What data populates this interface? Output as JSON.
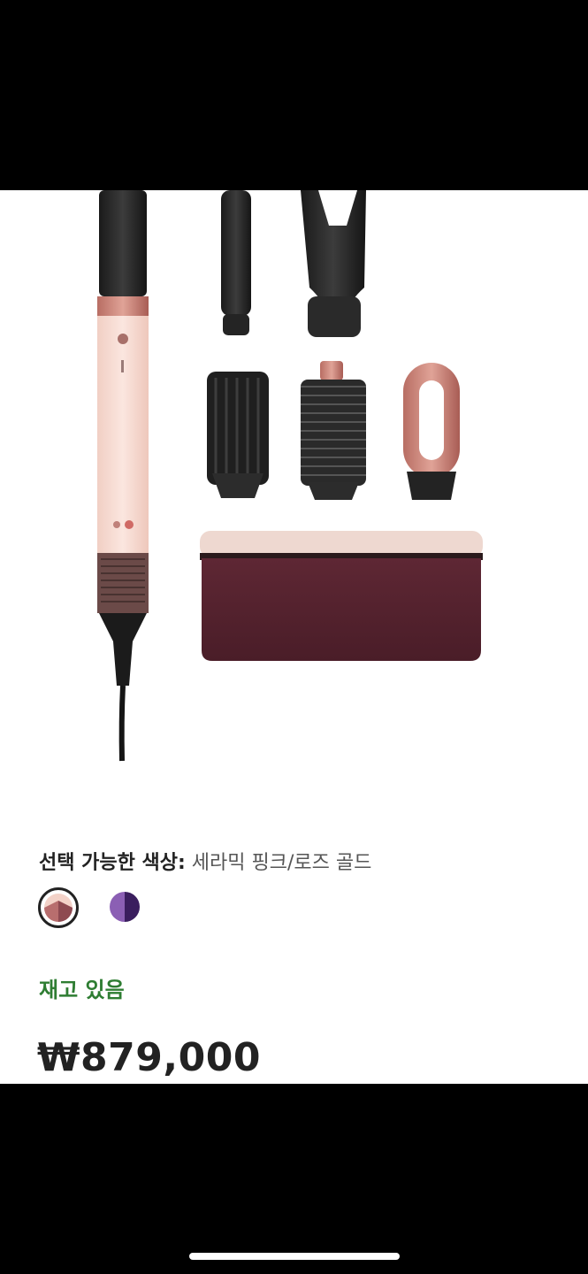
{
  "product": {
    "color_label": "선택 가능한 색상:",
    "color_value": "세라믹 핑크/로즈 골드",
    "stock_status": "재고 있음",
    "price": "₩879,000",
    "swatches": [
      {
        "name": "세라믹 핑크/로즈 골드",
        "selected": true,
        "colors": [
          "#f3d2c8",
          "#b86e6e",
          "#6b2d3a"
        ]
      },
      {
        "name": "purple",
        "selected": false,
        "colors": [
          "#8b5fb4",
          "#3a1e5e"
        ]
      }
    ]
  },
  "colors": {
    "stock_green": "#2e7d32",
    "case_burgundy": "#5c2632",
    "rose_gold": "#d38a7e",
    "ceramic_pink": "#f6dcd4"
  }
}
